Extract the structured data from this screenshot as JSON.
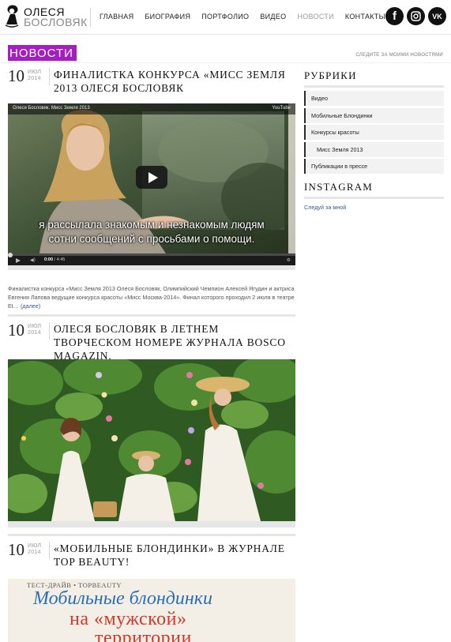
{
  "header": {
    "logo": {
      "line1": "ОЛЕСЯ",
      "line2": "БОСЛОВЯК"
    },
    "nav": [
      {
        "label": "ГЛАВНАЯ",
        "active": false
      },
      {
        "label": "БИОГРАФИЯ",
        "active": false
      },
      {
        "label": "ПОРТФОЛИО",
        "active": false
      },
      {
        "label": "ВИДЕО",
        "active": false
      },
      {
        "label": "НОВОСТИ",
        "active": true
      },
      {
        "label": "КОНТАКТЫ",
        "active": false
      }
    ],
    "social": [
      {
        "icon": "facebook-icon",
        "glyph": "f"
      },
      {
        "icon": "instagram-icon",
        "glyph": ""
      },
      {
        "icon": "vk-icon",
        "glyph": "VK"
      }
    ]
  },
  "section": {
    "title": "НОВОСТИ",
    "follow_link": "СЛЕДИТЕ ЗА МОИМИ НОВОСТЯМИ",
    "accent_color": "#a31fbf"
  },
  "posts": [
    {
      "day": "10",
      "month": "ИЮЛ",
      "year": "2014",
      "title": "ФИНАЛИСТКА КОНКУРСА «МИСС ЗЕМЛЯ 2013 ОЛЕСЯ БОСЛОВЯК",
      "video": {
        "title": "Олеся Бословяк. Мисс Земля 2013",
        "brand": "YouTube",
        "subtitle_line1": "я рассылала знакомым и незнакомым людям",
        "subtitle_line2": "сотни сообщений с просьбами о помощи.",
        "time_current": "0:00",
        "time_total": "/ 4:45",
        "progress": 0
      },
      "excerpt": "Финалистка конкурса «Мисс Земля 2013 Олеся Бословяк, Олимпийский Чемпион Алексей Ягудин и актриса Евгения Лапова ведущие конкурса красоты «Мисс Москва-2014». Финал которого проходил 2 июля в театре Et…",
      "more_link": "(далее)"
    },
    {
      "day": "10",
      "month": "ИЮЛ",
      "year": "2014",
      "title": "ОЛЕСЯ БОСЛОВЯК В ЛЕТНЕМ ТВОРЧЕСКОМ НОМЕРЕ ЖУРНАЛА BOSCO MAGAZIN."
    },
    {
      "day": "10",
      "month": "ИЮЛ",
      "year": "2014",
      "title": "«МОБИЛЬНЫЕ БЛОНДИНКИ» В ЖУРНАЛЕ TOP BEAUTY!",
      "magazine": {
        "header": "ТЕСТ-ДРАЙВ • TOPBEAUTY",
        "line1": "Мобильные блондинки",
        "line2": "на «мужской»",
        "line3": "территории"
      }
    }
  ],
  "sidebar": {
    "categories_title": "РУБРИКИ",
    "categories": [
      {
        "label": "Видео",
        "sub": false
      },
      {
        "label": "Мобильные Блондинки",
        "sub": false
      },
      {
        "label": "Конкурсы красоты",
        "sub": false
      },
      {
        "label": "Мисс Земля 2013",
        "sub": true
      },
      {
        "label": "Публикации в прессе",
        "sub": false
      }
    ],
    "instagram_title": "INSTAGRAM",
    "instagram_link": "Следуй за мной"
  }
}
